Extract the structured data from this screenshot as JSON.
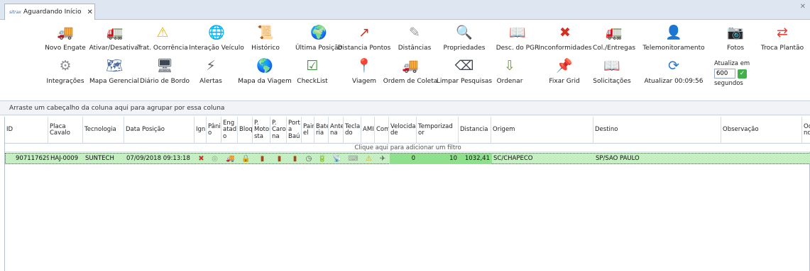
{
  "tab": {
    "logo": "sitrax",
    "title": "Aguardando Início",
    "close": "✕"
  },
  "window": {
    "close": "✕"
  },
  "ribbon_row1": [
    {
      "label": "Novo Engate",
      "icon": "truck-icon",
      "glyph": "🚚"
    },
    {
      "label": "Ativar/Desativar",
      "icon": "truck-check-icon",
      "glyph": "🚛"
    },
    {
      "label": "Trat. Ocorrência",
      "icon": "warning-icon",
      "glyph": "⚠"
    },
    {
      "label": "Interação Veículo",
      "icon": "globe-satellite-icon",
      "glyph": "🌐"
    },
    {
      "label": "Histórico",
      "icon": "history-icon",
      "glyph": "📜"
    },
    {
      "label": "Última Posição",
      "icon": "globe-icon",
      "glyph": "🌍"
    },
    {
      "label": "Distancia Pontos",
      "icon": "route-arrow-icon",
      "glyph": "↗"
    },
    {
      "label": "Distâncias",
      "icon": "ruler-icon",
      "glyph": "✎"
    },
    {
      "label": "Propriedades",
      "icon": "properties-icon",
      "glyph": "🔍"
    },
    {
      "label": "Desc. do PGR",
      "icon": "book-icon",
      "glyph": "📖"
    },
    {
      "label": "Inconformidades",
      "icon": "error-icon",
      "glyph": "✖"
    },
    {
      "label": "Col./Entregas",
      "icon": "truck-load-icon",
      "glyph": "🚛"
    },
    {
      "label": "Telemonitoramento",
      "icon": "user-icon",
      "glyph": "👤"
    },
    {
      "label": "Fotos",
      "icon": "camera-icon",
      "glyph": "📷"
    },
    {
      "label": "Troca Plantão",
      "icon": "swap-icon",
      "glyph": "⇄"
    }
  ],
  "ribbon_row2": [
    {
      "label": "Integrações",
      "icon": "gears-icon",
      "glyph": "⚙"
    },
    {
      "label": "Mapa Gerencial",
      "icon": "map-icon",
      "glyph": "🗺"
    },
    {
      "label": "Diário de Bordo",
      "icon": "monitor-icon",
      "glyph": "🖥"
    },
    {
      "label": "Alertas",
      "icon": "alert-icon",
      "glyph": "⚡"
    },
    {
      "label": "Mapa da Viagem",
      "icon": "globe-route-icon",
      "glyph": "🌎"
    },
    {
      "label": "CheckList",
      "icon": "checklist-icon",
      "glyph": "☑"
    },
    {
      "label": "Viagem",
      "icon": "map-pin-icon",
      "glyph": "📍"
    },
    {
      "label": "Ordem de Coleta",
      "icon": "collection-truck-icon",
      "glyph": "🚚"
    },
    {
      "label": "Limpar Pesquisas",
      "icon": "clear-icon",
      "glyph": "⌫"
    },
    {
      "label": "Ordenar",
      "icon": "sort-icon",
      "glyph": "⇩"
    },
    {
      "label": "Fixar Grid",
      "icon": "pin-icon",
      "glyph": "📌"
    },
    {
      "label": "Solicitações",
      "icon": "requests-icon",
      "glyph": "📖"
    },
    {
      "label": "Atualizar 00:09:56",
      "icon": "refresh-icon",
      "glyph": "⟳"
    }
  ],
  "refresh": {
    "label_top": "Atualiza em",
    "value": "600",
    "label_bottom": "segundos",
    "ok": "✓"
  },
  "groupbar": "Arraste um cabeçalho da coluna aqui para agrupar por essa coluna",
  "columns": [
    "ID",
    "Placa Cavalo",
    "Tecnologia",
    "Data Posição",
    "Ign",
    "Pânico",
    "Engatado",
    "Bloq",
    "P. Motorista",
    "P. Carona",
    "Port a Baú",
    "Painel",
    "Bateria",
    "Antena",
    "Teclado",
    "AMI",
    "Com",
    "Velocidade",
    "Temporizador",
    "Distancia",
    "Origem",
    "Destino",
    "Observação",
    "Ocorrência"
  ],
  "columns_display": [
    "ID",
    "Placa\nCavalo",
    "Tecnologia",
    "Data Posição",
    "Ign",
    "Pânic\no",
    "Eng\natad\no",
    "Bloq",
    "P.\nMotori\nsta",
    "P.\nCaro\nna",
    "Port\na\nBaú",
    "Pain\nel",
    "Bate\nria",
    "Ante\nna",
    "Tecla\ndo",
    "AMI",
    "Com",
    "Velocida\nde",
    "Temporizad\nor",
    "Distancia",
    "Origem",
    "Destino",
    "Observação",
    "Oc\nnc"
  ],
  "filter_hint": "Clique aqui para adicionar um filtro",
  "rows": [
    {
      "id": "907117629",
      "placa": "HAJ-0009",
      "tecnologia": "SUNTECH",
      "data": "07/09/2018 09:13:18",
      "ign": "✖",
      "panico": "◎",
      "engatado": "🚚",
      "bloq": "🔒",
      "motorista": "▮",
      "carona": "▮",
      "porta": "▮",
      "painel": "◷",
      "bateria": "🔋",
      "antena": "📡",
      "teclado": "⌨",
      "ami": "⚠",
      "com": "✈",
      "velocidade": "0",
      "temporizador": "10",
      "distancia": "1032,41",
      "origem": "SC/CHAPECO",
      "destino": "SP/SAO PAULO",
      "observacao": ""
    }
  ]
}
